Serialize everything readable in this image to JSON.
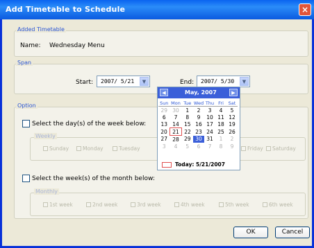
{
  "window": {
    "title": "Add Timetable to Schedule",
    "close_icon": "×"
  },
  "added_timetable": {
    "group_label": "Added Timetable",
    "name_label": "Name:",
    "name_value": "Wednesday Menu"
  },
  "span": {
    "group_label": "Span",
    "start_label": "Start:",
    "start_value": "2007/ 5/21",
    "end_label": "End:",
    "end_value": "2007/ 5/30"
  },
  "option": {
    "group_label": "Option",
    "days_checkbox_label": "Select the day(s) of the week below:",
    "weekly_label": "Weekly",
    "weekdays": [
      "Sunday",
      "Monday",
      "Tuesday",
      "Friday",
      "Saturday"
    ],
    "weeks_checkbox_label": "Select the week(s) of the month below:",
    "monthly_label": "Monthly",
    "weeks": [
      "1st week",
      "2nd week",
      "3rd week",
      "4th week",
      "5th week",
      "6th week"
    ]
  },
  "calendar": {
    "month_label": "May, 2007",
    "prev_icon": "◀",
    "next_icon": "▶",
    "day_headers": [
      "Sun",
      "Mon",
      "Tue",
      "Wed",
      "Thu",
      "Fri",
      "Sat"
    ],
    "rows": [
      [
        "29",
        "30",
        "1",
        "2",
        "3",
        "4",
        "5"
      ],
      [
        "6",
        "7",
        "8",
        "9",
        "10",
        "11",
        "12"
      ],
      [
        "13",
        "14",
        "15",
        "16",
        "17",
        "18",
        "19"
      ],
      [
        "20",
        "21",
        "22",
        "23",
        "24",
        "25",
        "26"
      ],
      [
        "27",
        "28",
        "29",
        "30",
        "31",
        "1",
        "2"
      ],
      [
        "3",
        "4",
        "5",
        "6",
        "7",
        "8",
        "9"
      ]
    ],
    "today_label": "Today: 5/21/2007"
  },
  "buttons": {
    "ok": "OK",
    "cancel": "Cancel"
  },
  "colors": {
    "title_bar": "#0a64f0",
    "accent": "#3b5fd9",
    "today_marker": "#e05050"
  }
}
